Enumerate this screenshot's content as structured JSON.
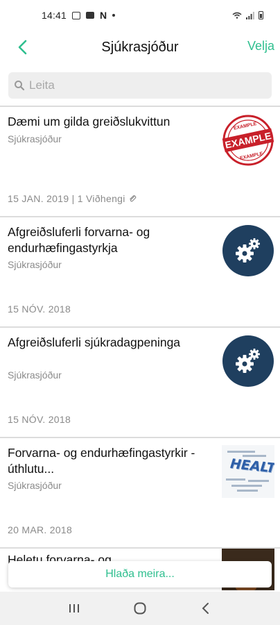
{
  "status_bar": {
    "time": "14:41",
    "notification_letter": "N"
  },
  "header": {
    "title": "Sjúkrasjóður",
    "select_label": "Velja",
    "back_icon": "chevron-left-icon"
  },
  "search": {
    "placeholder": "Leita",
    "value": ""
  },
  "colors": {
    "accent": "#2fbf8f",
    "gear_circle": "#1f3f5f",
    "stamp_red": "#c8202a"
  },
  "items": [
    {
      "title": "Dæmi um gilda greiðslukvittun",
      "subtitle": "Sjúkrasjóður",
      "date": "15 JAN. 2019 | 1 Viðhengi",
      "thumbnail": "example-stamp",
      "stamp_top": "EXAMPLE",
      "stamp_main": "EXAMPLE",
      "stamp_bottom": "EXAMPLE"
    },
    {
      "title": "Afgreiðsluferli forvarna- og endurhæfingastyrkja",
      "subtitle": "Sjúkrasjóður",
      "date": "15 NÓV. 2018",
      "thumbnail": "gears-icon"
    },
    {
      "title": "Afgreiðsluferli sjúkradagpeninga",
      "subtitle": "Sjúkrasjóður",
      "date": "15 NÓV. 2018",
      "thumbnail": "gears-icon"
    },
    {
      "title": "Forvarna- og endurhæfingastyrkir - úthlutu...",
      "subtitle": "Sjúkrasjóður",
      "date": "20 MAR. 2018",
      "thumbnail": "health-word-cloud",
      "thumb_word": "HEALTH"
    },
    {
      "title": "Heletu forvarna- og",
      "thumbnail": "photo"
    }
  ],
  "load_more_label": "Hlaða meira...",
  "nav_bar": {
    "buttons": [
      "recent-apps-icon",
      "home-icon",
      "back-icon"
    ]
  }
}
